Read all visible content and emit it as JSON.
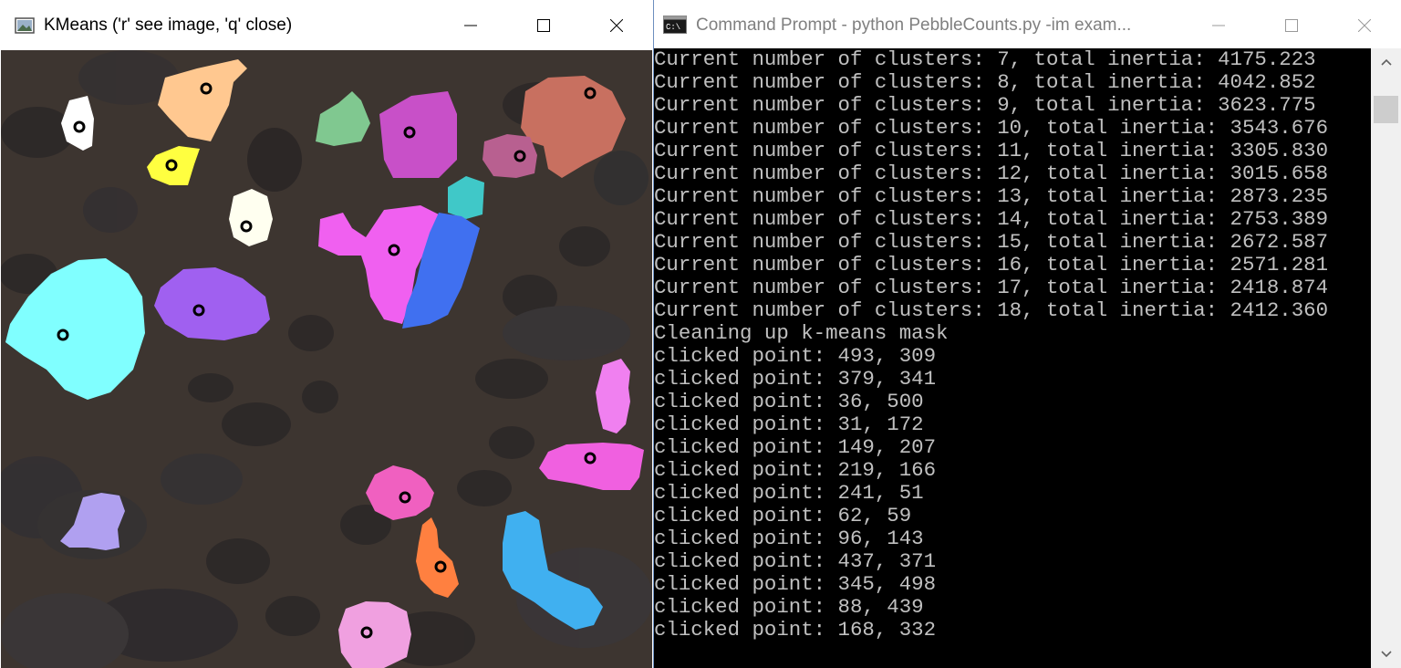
{
  "kmeans_window": {
    "title": "KMeans ('r' see image, 'q' close)",
    "controls": {
      "minimize": "minimize",
      "maximize": "maximize",
      "close": "close"
    },
    "image": {
      "description_icon": "image-icon",
      "background_color": "#3d3530",
      "cluster_colors": [
        "#ffffff",
        "#ffc890",
        "#ffff40",
        "#80c890",
        "#c850c8",
        "#c87060",
        "#b86090",
        "#40c8c8",
        "#f060f0",
        "#4070f0",
        "#80ffff",
        "#a060f0",
        "#fffff0",
        "#f080f0",
        "#f060e0",
        "#f060c0",
        "#b0a0f0",
        "#ff8040",
        "#40b0f0",
        "#f0a0e0"
      ]
    }
  },
  "cmd_window": {
    "title": "Command Prompt - python  PebbleCounts.py -im exam...",
    "icon": "cmd-icon",
    "controls": {
      "minimize": "minimize",
      "maximize": "maximize",
      "close": "close"
    },
    "lines": [
      "Current number of clusters: 7, total inertia: 4175.223",
      "Current number of clusters: 8, total inertia: 4042.852",
      "Current number of clusters: 9, total inertia: 3623.775",
      "Current number of clusters: 10, total inertia: 3543.676",
      "Current number of clusters: 11, total inertia: 3305.830",
      "Current number of clusters: 12, total inertia: 3015.658",
      "Current number of clusters: 13, total inertia: 2873.235",
      "Current number of clusters: 14, total inertia: 2753.389",
      "Current number of clusters: 15, total inertia: 2672.587",
      "Current number of clusters: 16, total inertia: 2571.281",
      "Current number of clusters: 17, total inertia: 2418.874",
      "Current number of clusters: 18, total inertia: 2412.360",
      "Cleaning up k-means mask",
      "clicked point: 493, 309",
      "clicked point: 379, 341",
      "clicked point: 36, 500",
      "clicked point: 31, 172",
      "clicked point: 149, 207",
      "clicked point: 219, 166",
      "clicked point: 241, 51",
      "clicked point: 62, 59",
      "clicked point: 96, 143",
      "clicked point: 437, 371",
      "clicked point: 345, 498",
      "clicked point: 88, 439",
      "clicked point: 168, 332"
    ],
    "text_color": "#c0c0c0",
    "background_color": "#000000"
  }
}
